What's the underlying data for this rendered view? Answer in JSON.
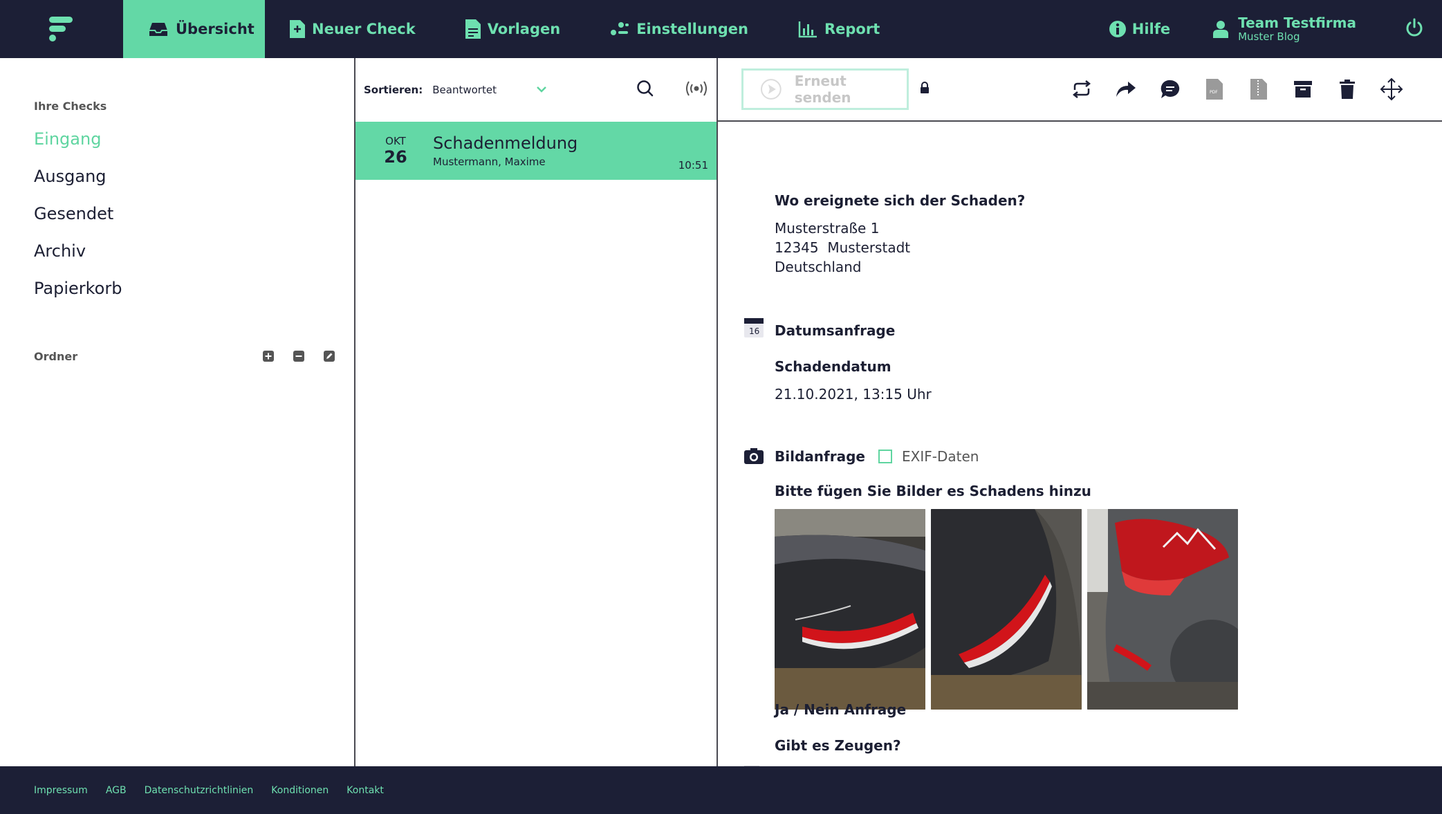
{
  "nav": {
    "items": [
      {
        "label": "Übersicht",
        "icon": "inbox-icon",
        "active": true
      },
      {
        "label": "Neuer Check",
        "icon": "plus-doc-icon"
      },
      {
        "label": "Vorlagen",
        "icon": "document-icon"
      },
      {
        "label": "Einstellungen",
        "icon": "settings-icon"
      },
      {
        "label": "Report",
        "icon": "chart-icon"
      }
    ],
    "help": "Hilfe",
    "team_name": "Team Testfirma",
    "team_sub": "Muster Blog"
  },
  "sidebar": {
    "heading": "Ihre Checks",
    "items": [
      {
        "label": "Eingang",
        "active": true
      },
      {
        "label": "Ausgang"
      },
      {
        "label": "Gesendet"
      },
      {
        "label": "Archiv"
      },
      {
        "label": "Papierkorb"
      }
    ],
    "folders_heading": "Ordner"
  },
  "list": {
    "sort_label": "Sortieren:",
    "sort_value": "Beantwortet",
    "messages": [
      {
        "month": "OKT",
        "day": "26",
        "title": "Schadenmeldung",
        "who": "Mustermann, Maxime",
        "time": "10:51"
      }
    ]
  },
  "detail": {
    "resend_label": "Erneut senden",
    "q1": "Wo ereignete sich der Schaden?",
    "addr1": "Musterstraße 1",
    "addr2": "12345  Musterstadt",
    "addr3": "Deutschland",
    "date_section": "Datumsanfrage",
    "cal_day": "16",
    "date_q": "Schadendatum",
    "date_val": "21.10.2021, 13:15 Uhr",
    "image_section": "Bildanfrage",
    "exif_label": "EXIF-Daten",
    "image_q": "Bitte fügen Sie Bilder es Schadens hinzu",
    "yesno_section": "Ja / Nein Anfrage",
    "yesno_q": "Gibt es Zeugen?"
  },
  "footer": [
    "Impressum",
    "AGB",
    "Datenschutzrichtlinien",
    "Konditionen",
    "Kontakt"
  ],
  "colors": {
    "dark": "#1c1f36",
    "accent": "#63d8a6",
    "accent_text": "#6ee0b0"
  }
}
